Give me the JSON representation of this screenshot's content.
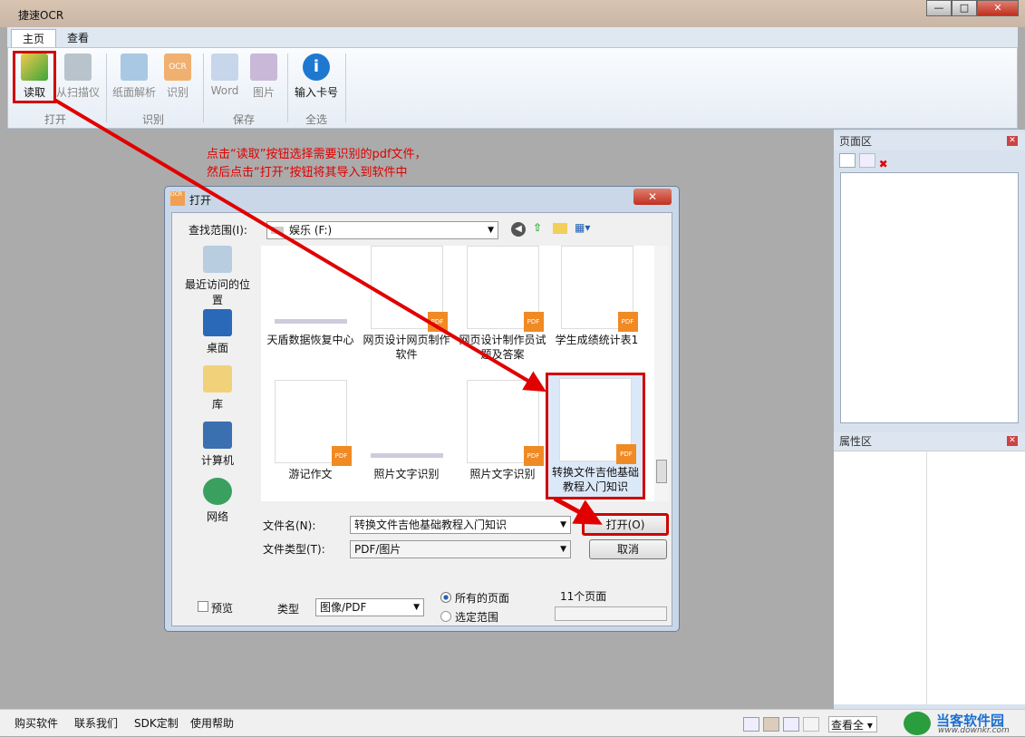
{
  "app": {
    "title": "捷速OCR"
  },
  "tabs": [
    "主页",
    "查看"
  ],
  "ribbon": {
    "buttons": [
      "读取",
      "从扫描仪",
      "纸面解析",
      "识别",
      "Word",
      "图片",
      "输入卡号"
    ],
    "groups": [
      "打开",
      "识别",
      "保存",
      "全选"
    ]
  },
  "annotation": {
    "line1": "点击“读取”按钮选择需要识别的pdf文件，",
    "line2": "然后点击“打开”按钮将其导入到软件中"
  },
  "dialog": {
    "title": "打开",
    "lookin_label": "查找范围(I):",
    "lookin_value": "娱乐 (F:)",
    "places": [
      "最近访问的位置",
      "桌面",
      "库",
      "计算机",
      "网络"
    ],
    "files": [
      "天盾数据恢复中心",
      "网页设计网页制作软件",
      "网页设计制作员试题及答案",
      "学生成绩统计表1",
      "游记作文",
      "照片文字识别",
      "照片文字识别",
      "转换文件吉他基础教程入门知识"
    ],
    "filename_label": "文件名(N):",
    "filename_value": "转换文件吉他基础教程入门知识",
    "filetype_label": "文件类型(T):",
    "filetype_value": "PDF/图片",
    "open_button": "打开(O)",
    "cancel_button": "取消",
    "preview_label": "预览",
    "type_label": "类型",
    "type_value": "图像/PDF",
    "radio_all": "所有的页面",
    "radio_range": "选定范围",
    "page_count": "11个页面"
  },
  "right_panel": {
    "page_area": "页面区",
    "property_area": "属性区"
  },
  "status": {
    "links": [
      "购买软件",
      "联系我们",
      "SDK定制",
      "使用帮助"
    ],
    "view_select": "查看全"
  },
  "watermark": {
    "name": "当客软件园",
    "url": "www.downkr.com"
  }
}
